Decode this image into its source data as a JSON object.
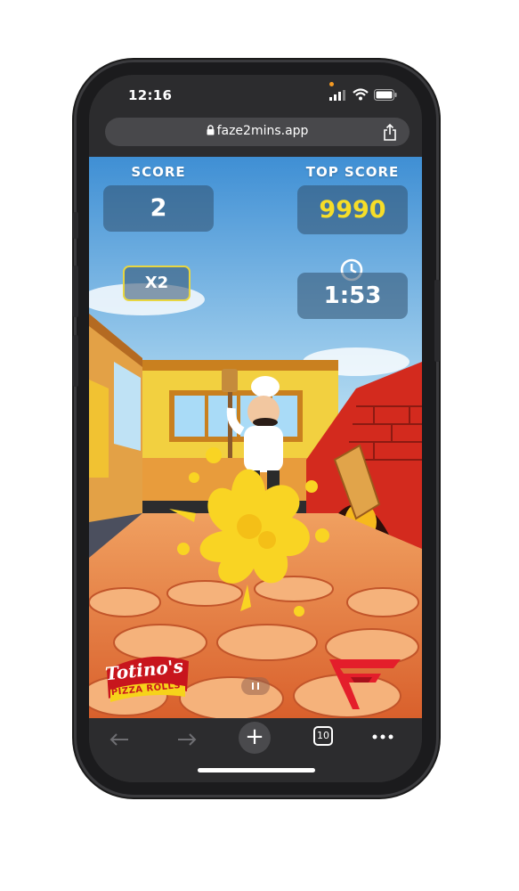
{
  "status_bar": {
    "time": "12:16"
  },
  "browser": {
    "url": "faze2mins.app",
    "tab_count": "10"
  },
  "game": {
    "score_label": "SCORE",
    "score_value": "2",
    "top_score_label": "TOP SCORE",
    "top_score_value": "9990",
    "multiplier": "X2",
    "timer": "1:53"
  },
  "branding": {
    "sponsor_line1": "Totino's",
    "sponsor_line2": "PIZZA ROLLS",
    "team_logo": "FaZe"
  },
  "colors": {
    "top_score": "#f6dd28",
    "hud_panel": "#32506e",
    "splat": "#f9d423",
    "totinos_red": "#c8151d",
    "faze_red": "#e41e2b"
  },
  "icons": [
    "lock-icon",
    "share-icon",
    "clock-icon",
    "pause-icon",
    "back-icon",
    "forward-icon",
    "plus-icon",
    "tabs-icon",
    "more-icon"
  ]
}
